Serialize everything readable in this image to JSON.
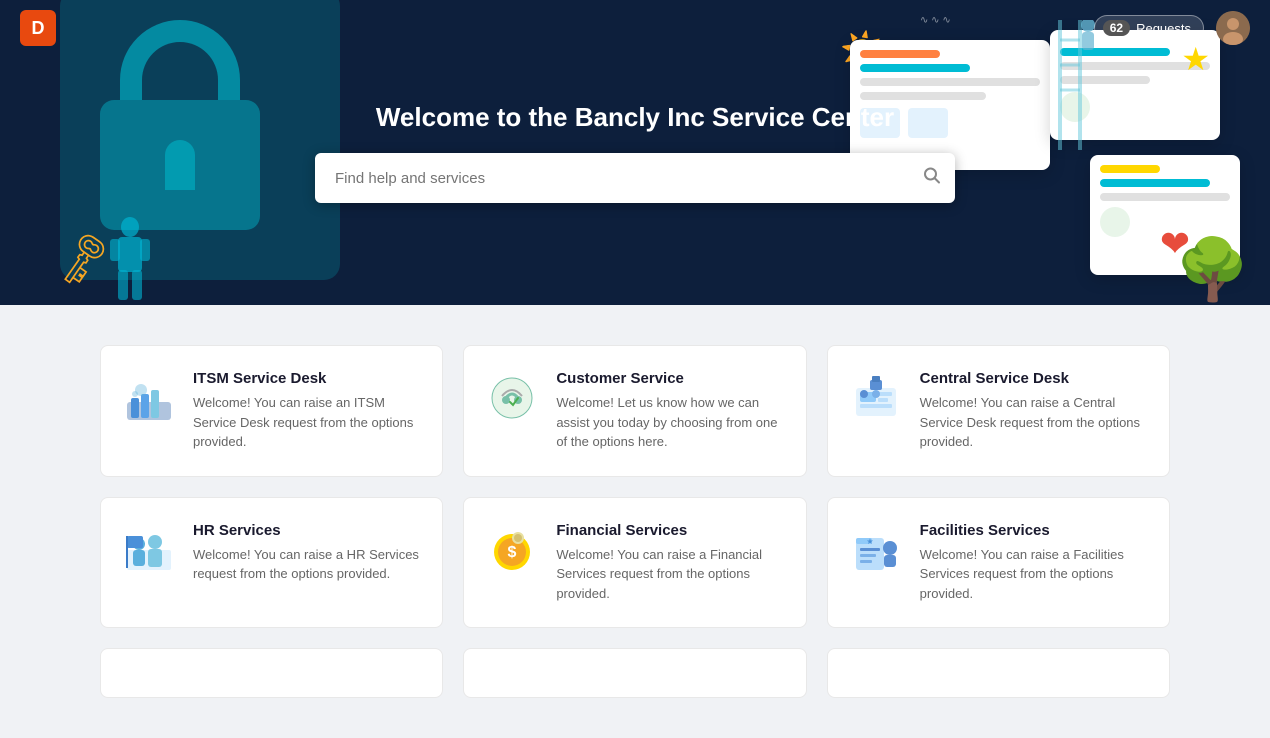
{
  "topbar": {
    "logo_text": "D",
    "requests_label": "Requests",
    "requests_count": "62",
    "avatar_emoji": "👤"
  },
  "hero": {
    "title": "Welcome to the Bancly Inc Service Center",
    "search_placeholder": "Find help and services"
  },
  "services": [
    {
      "id": "itsm",
      "title": "ITSM Service Desk",
      "description": "Welcome! You can raise an ITSM Service Desk request from the options provided.",
      "icon_color": "#4a90d9"
    },
    {
      "id": "customer",
      "title": "Customer Service",
      "description": "Welcome! Let us know how we can assist you today by choosing from one of the options here.",
      "icon_color": "#78c0a8"
    },
    {
      "id": "central",
      "title": "Central Service Desk",
      "description": "Welcome! You can raise a Central Service Desk request from the options provided.",
      "icon_color": "#5a8fd4"
    },
    {
      "id": "hr",
      "title": "HR Services",
      "description": "Welcome! You can raise a HR Services request from the options provided.",
      "icon_color": "#5aafdd"
    },
    {
      "id": "financial",
      "title": "Financial Services",
      "description": "Welcome! You can raise a Financial Services request from the options provided.",
      "icon_color": "#f5a623"
    },
    {
      "id": "facilities",
      "title": "Facilities Services",
      "description": "Welcome! You can raise a Facilities Services request from the options provided.",
      "icon_color": "#5a8fd4"
    }
  ]
}
